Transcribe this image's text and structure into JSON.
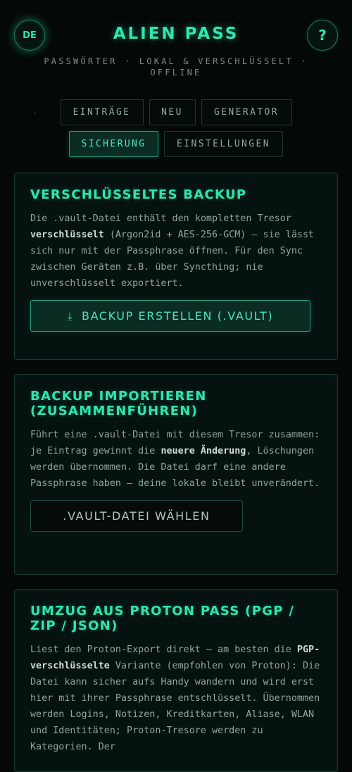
{
  "header": {
    "lang_label": "DE",
    "title": "ALIEN PASS",
    "subtitle": "PASSWÖRTER · LOKAL & VERSCHLÜSSELT · OFFLINE",
    "help_label": "?"
  },
  "nav": {
    "separator": "·",
    "tabs": [
      {
        "label": "EINTRÄGE"
      },
      {
        "label": "NEU"
      },
      {
        "label": "GENERATOR"
      },
      {
        "label": "SICHERUNG"
      },
      {
        "label": "EINSTELLUNGEN"
      }
    ]
  },
  "backup_card": {
    "title": "Verschlüsseltes Backup",
    "desc_before": "Die .vault-Datei enthält den kompletten Tresor ",
    "desc_strong": "verschlüsselt",
    "desc_after": " (Argon2id + AES-256-GCM) — sie lässt sich nur mit der Passphrase öffnen. Für den Sync zwischen Geräten z.B. über Syncthing; nie unverschlüsselt exportiert.",
    "button_icon": "download-icon",
    "button_label": "Backup erstellen (.vault)"
  },
  "import_card": {
    "title": "Backup importieren (zusammenführen)",
    "desc_before": "Führt eine .vault-Datei mit diesem Tresor zusammen: je Eintrag gewinnt die ",
    "desc_strong": "neuere Änderung",
    "desc_after": ", Löschungen werden übernommen. Die Datei darf eine andere Passphrase haben — deine lokale bleibt unverändert.",
    "button_label": ".vault-Datei wählen"
  },
  "proton_card": {
    "title": "Umzug aus Proton Pass (PGP / ZIP / JSON)",
    "desc_before": "Liest den Proton-Export direkt — am besten die ",
    "desc_strong": "PGP-verschlüsselte",
    "desc_after": " Variante (empfohlen von Proton): Die Datei kann sicher aufs Handy wandern und wird erst hier mit ihrer Passphrase entschlüsselt. Übernommen werden Logins, Notizen, Kreditkarten, Aliase, WLAN und Identitäten; Proton-Tresore werden zu Kategorien. Der"
  },
  "colors": {
    "accent": "#2ee6b0",
    "background": "#040807",
    "card": "#061210",
    "border": "#173a30"
  }
}
